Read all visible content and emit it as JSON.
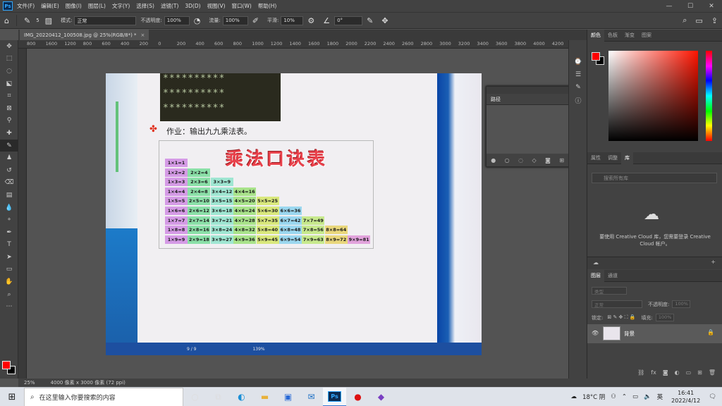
{
  "menubar": {
    "logo": "Ps",
    "items": [
      "文件(F)",
      "编辑(E)",
      "图像(I)",
      "图层(L)",
      "文字(Y)",
      "选择(S)",
      "滤镜(T)",
      "3D(D)",
      "视图(V)",
      "窗口(W)",
      "帮助(H)"
    ],
    "window_controls": [
      "—",
      "☐",
      "✕"
    ]
  },
  "options": {
    "brush_size": "5",
    "mode_label": "模式:",
    "mode_value": "正常",
    "opacity_label": "不透明度:",
    "opacity_value": "100%",
    "flow_label": "流量:",
    "flow_value": "100%",
    "smooth_label": "平滑:",
    "smooth_value": "10%",
    "angle_value": "0°"
  },
  "document": {
    "tab_title": "IMG_20220412_100508.jpg @ 25%(RGB/8*) *",
    "close": "×"
  },
  "ruler_ticks": [
    "800",
    "1600",
    "1200",
    "800",
    "600",
    "400",
    "200",
    "0",
    "200",
    "400",
    "600",
    "800",
    "1000",
    "1200",
    "1400",
    "1600",
    "1800",
    "2000",
    "2200",
    "2400",
    "2600",
    "2800",
    "3000",
    "3200",
    "3400",
    "3600",
    "3800",
    "4000",
    "4200",
    "4400",
    "4600",
    "4"
  ],
  "photo": {
    "stars": [
      "**********",
      "**********",
      "**********"
    ],
    "homework": "作业：输出九九乘法表。",
    "table_title": "乘法口诀表",
    "rows": [
      [
        "1×1=1"
      ],
      [
        "1×2=2",
        "2×2=4"
      ],
      [
        "1×3=3",
        "2×3=6",
        "3×3=9"
      ],
      [
        "1×4=4",
        "2×4=8",
        "3×4=12",
        "4×4=16"
      ],
      [
        "1×5=5",
        "2×5=10",
        "3×5=15",
        "4×5=20",
        "5×5=25"
      ],
      [
        "1×6=6",
        "2×6=12",
        "3×6=18",
        "4×6=24",
        "5×6=30",
        "6×6=36"
      ],
      [
        "1×7=7",
        "2×7=14",
        "3×7=21",
        "4×7=28",
        "5×7=35",
        "6×7=42",
        "7×7=49"
      ],
      [
        "1×8=8",
        "2×8=16",
        "3×8=24",
        "4×8=32",
        "5×8=40",
        "6×8=48",
        "7×8=56",
        "8×8=64"
      ],
      [
        "1×9=9",
        "2×9=18",
        "3×9=27",
        "4×9=36",
        "5×9=45",
        "6×9=54",
        "7×9=63",
        "8×9=72",
        "9×9=81"
      ]
    ],
    "cell_colors": [
      "#d59be6",
      "#8be0a8",
      "#9fe6d2",
      "#a9e38b",
      "#d9e87c",
      "#9bd7ef",
      "#c7e98d",
      "#e9d77c",
      "#e2a3dc"
    ],
    "page_indicator": "9 / 9",
    "zoom_in_photo": "139%"
  },
  "paths_panel": {
    "tab": "路径"
  },
  "right_panels": {
    "color_tabs": [
      "颜色",
      "色板",
      "渐变",
      "图案"
    ],
    "lib_tabs": [
      "属性",
      "调整",
      "库"
    ],
    "lib_search_placeholder": "搜索所有库",
    "cc_message": "要使用 Creative Cloud 库，您需要登录 Creative Cloud 帐户。",
    "layer_tabs": [
      "图层",
      "通道"
    ],
    "kind_label": "类型",
    "blend_mode": "正常",
    "opacity_label": "不透明度:",
    "opacity_value": "100%",
    "lock_label": "锁定:",
    "fill_label": "填充:",
    "fill_value": "100%",
    "layer_name": "背景"
  },
  "status": {
    "zoom": "25%",
    "doc_info": "4000 像素 x 3000 像素 (72 ppi)"
  },
  "taskbar": {
    "search_placeholder": "在这里输入你要搜索的内容",
    "weather": "18°C 阴",
    "ime": "英",
    "time": "16:41",
    "date": "2022/4/12"
  },
  "colors": {
    "foreground": "#ff0000",
    "background": "#000000",
    "accent": "#31a8ff"
  }
}
